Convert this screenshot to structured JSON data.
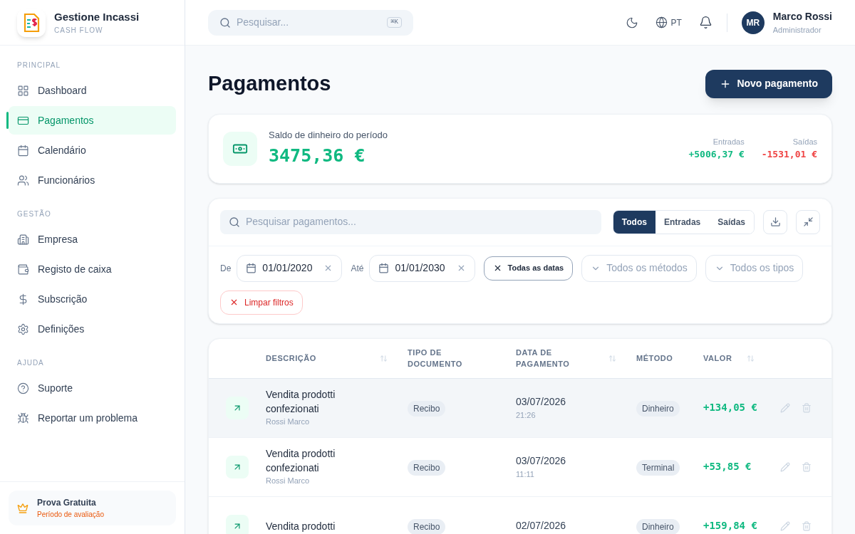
{
  "brand": {
    "name": "Gestione Incassi",
    "tagline": "CASH FLOW"
  },
  "sidebar": {
    "sections": [
      {
        "label": "PRINCIPAL",
        "items": [
          {
            "label": "Dashboard",
            "selected": false
          },
          {
            "label": "Pagamentos",
            "selected": true
          },
          {
            "label": "Calendário",
            "selected": false
          },
          {
            "label": "Funcionários",
            "selected": false
          }
        ]
      },
      {
        "label": "GESTÃO",
        "items": [
          {
            "label": "Empresa",
            "selected": false
          },
          {
            "label": "Registo de caixa",
            "selected": false
          },
          {
            "label": "Subscrição",
            "selected": false
          },
          {
            "label": "Definições",
            "selected": false
          }
        ]
      },
      {
        "label": "AJUDA",
        "items": [
          {
            "label": "Suporte",
            "selected": false
          },
          {
            "label": "Reportar um problema",
            "selected": false
          }
        ]
      }
    ],
    "plan": {
      "title": "Prova Gratuita",
      "subtitle": "Período de avaliação"
    }
  },
  "topbar": {
    "search_placeholder": "Pesquisar...",
    "shortcut": "⌘K",
    "language": "PT",
    "user": {
      "initials": "MR",
      "name": "Marco Rossi",
      "role": "Administrador"
    }
  },
  "page": {
    "title": "Pagamentos",
    "new_button": "Novo pagamento"
  },
  "balance": {
    "label": "Saldo de dinheiro do período",
    "amount": "3475,36 €",
    "inflow_label": "Entradas",
    "inflow": "+5006,37 €",
    "outflow_label": "Saídas",
    "outflow": "-1531,01 €"
  },
  "filters": {
    "search_placeholder": "Pesquisar pagamentos...",
    "tabs": [
      {
        "label": "Todos",
        "selected": true
      },
      {
        "label": "Entradas",
        "selected": false
      },
      {
        "label": "Saídas",
        "selected": false
      }
    ],
    "from_label": "De",
    "from": "01/01/2020",
    "to_label": "Até",
    "to": "01/01/2030",
    "all_dates": "Todas as datas",
    "methods_placeholder": "Todos os métodos",
    "types_placeholder": "Todos os tipos",
    "clear": "Limpar filtros"
  },
  "table": {
    "columns": [
      {
        "label": "DESCRIÇÃO",
        "sortable": true
      },
      {
        "label": "TIPO DE DOCUMENTO",
        "sortable": false
      },
      {
        "label": "DATA DE PAGAMENTO",
        "sortable": true
      },
      {
        "label": "MÉTODO",
        "sortable": false
      },
      {
        "label": "VALOR",
        "sortable": true
      }
    ],
    "rows": [
      {
        "description": "Vendita prodotti confezionati",
        "author": "Rossi Marco",
        "type": "Recibo",
        "date": "03/07/2026",
        "time": "21:26",
        "method": "Dinheiro",
        "amount": "+134,05 €",
        "selected": true
      },
      {
        "description": "Vendita prodotti confezionati",
        "author": "Rossi Marco",
        "type": "Recibo",
        "date": "03/07/2026",
        "time": "11:11",
        "method": "Terminal",
        "amount": "+53,85 €",
        "selected": false
      },
      {
        "description": "Vendita prodotti",
        "type": "Recibo",
        "date": "02/07/2026",
        "method": "Dinheiro",
        "amount": "+159,84 €",
        "selected": false
      }
    ]
  }
}
